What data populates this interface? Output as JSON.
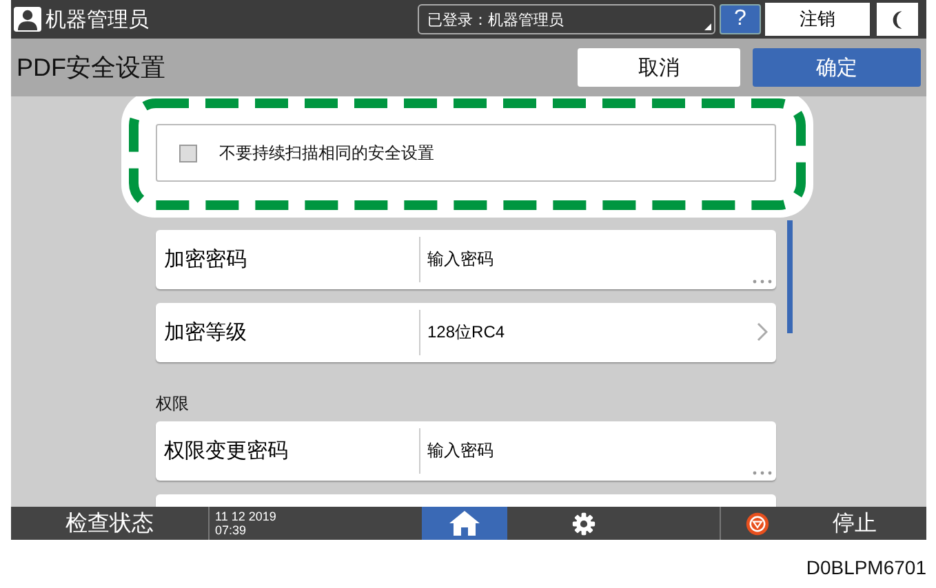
{
  "header": {
    "user": "机器管理员",
    "login_status": "已登录：机器管理员",
    "help": "?",
    "logout": "注销"
  },
  "title_bar": {
    "title": "PDF安全设置",
    "buttons": [
      {
        "label": "取消",
        "kind": "secondary"
      },
      {
        "label": "确定",
        "kind": "primary"
      }
    ]
  },
  "option": {
    "label": "不要持续扫描相同的安全设置",
    "checked": false
  },
  "sections": [
    {
      "rows": [
        {
          "label": "加密密码",
          "value": "输入密码",
          "kind": "input"
        },
        {
          "label": "加密等级",
          "value": "128位RC4",
          "kind": "select"
        }
      ]
    },
    {
      "title": "权限",
      "rows": [
        {
          "label": "权限变更密码",
          "value": "输入密码",
          "kind": "input"
        },
        {
          "kind": "blank"
        }
      ]
    }
  ],
  "status_bar": {
    "check_status": "检查状态",
    "date": "11 12 2019",
    "time": "07:39",
    "home_selected": true,
    "stop": "停止"
  },
  "figure_id": "D0BLPM6701"
}
